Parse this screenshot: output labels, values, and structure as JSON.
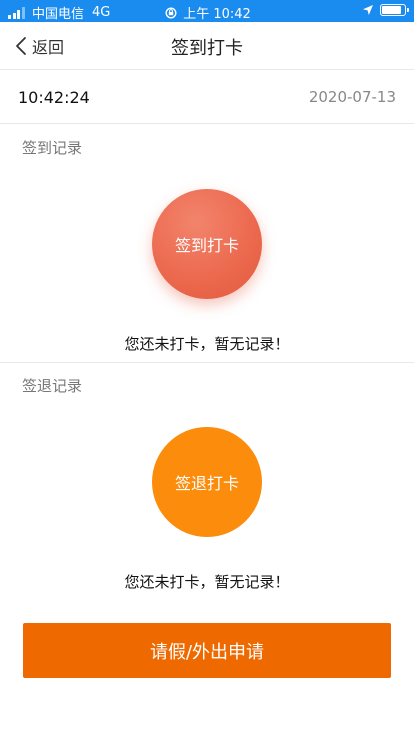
{
  "status_bar": {
    "carrier": "中国电信",
    "network": "4G",
    "time": "上午 10:42",
    "icons": [
      "signal-icon",
      "lock-rotation-icon",
      "location-icon",
      "battery-icon"
    ],
    "battery_level": 0.85
  },
  "nav": {
    "back_label": "返回",
    "title": "签到打卡"
  },
  "clock": {
    "time": "10:42:24",
    "date": "2020-07-13"
  },
  "sign_in": {
    "section_label": "签到记录",
    "button_label": "签到打卡",
    "empty_message": "您还未打卡，暂无记录！",
    "color": "#ec6a4f"
  },
  "sign_out": {
    "section_label": "签退记录",
    "button_label": "签退打卡",
    "empty_message": "您还未打卡，暂无记录！",
    "color": "#fb8c0c"
  },
  "apply_button": {
    "label": "请假/外出申请",
    "color": "#ee6a00"
  },
  "colors": {
    "status_bar": "#1a8cf0"
  }
}
